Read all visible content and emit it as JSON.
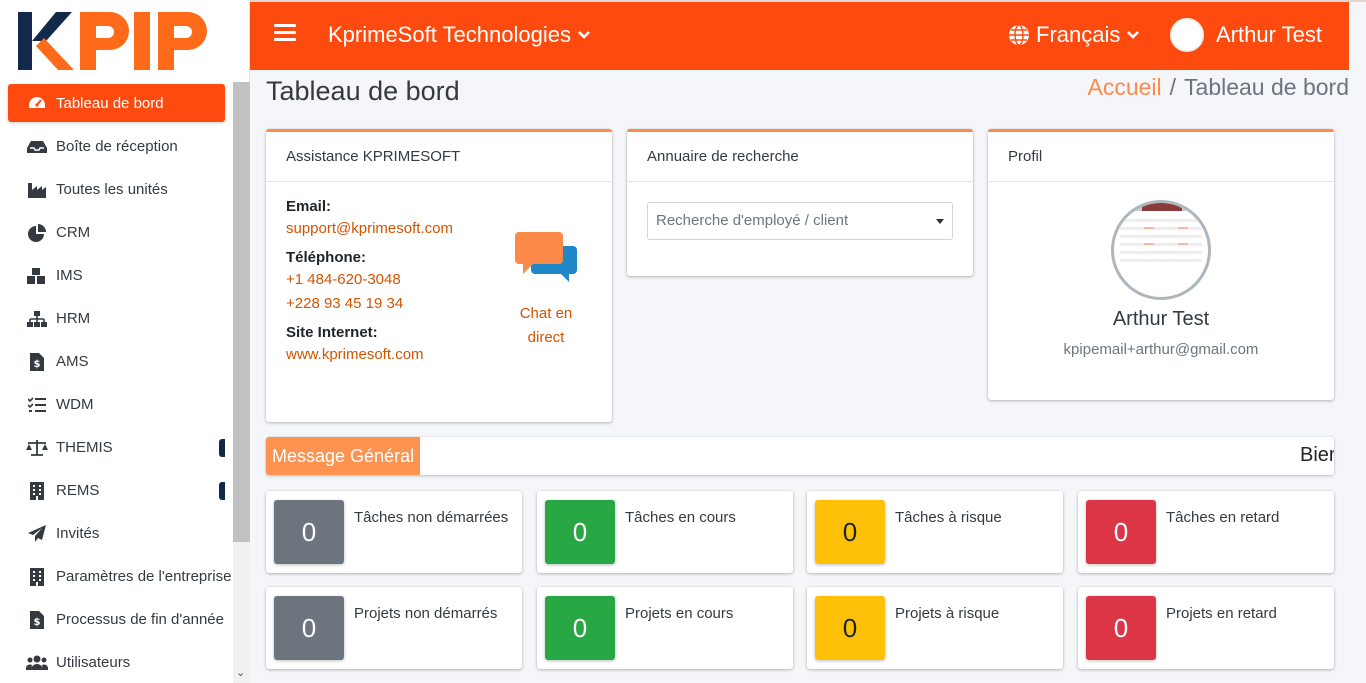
{
  "brand": {
    "logo_text": "KPIP",
    "accent": "#fd4b10"
  },
  "topbar": {
    "company": "KprimeSoft Technologies",
    "language": "Français",
    "user": "Arthur Test"
  },
  "sidebar": {
    "items": [
      {
        "label": "Tableau de bord",
        "icon": "dashboard-icon"
      },
      {
        "label": "Boîte de réception",
        "icon": "inbox-icon"
      },
      {
        "label": "Toutes les unités",
        "icon": "industry-icon"
      },
      {
        "label": "CRM",
        "icon": "pie-chart-icon"
      },
      {
        "label": "IMS",
        "icon": "boxes-icon"
      },
      {
        "label": "HRM",
        "icon": "sitemap-icon"
      },
      {
        "label": "AMS",
        "icon": "file-dollar-icon"
      },
      {
        "label": "WDM",
        "icon": "tasks-icon"
      },
      {
        "label": "THEMIS",
        "icon": "balance-scale-icon"
      },
      {
        "label": "REMS",
        "icon": "building-icon"
      },
      {
        "label": "Invités",
        "icon": "paper-plane-icon"
      },
      {
        "label": "Paramètres de l'entreprise",
        "icon": "building-icon"
      },
      {
        "label": "Processus de fin d'année",
        "icon": "file-dollar-icon"
      },
      {
        "label": "Utilisateurs",
        "icon": "users-icon"
      }
    ]
  },
  "page": {
    "title": "Tableau de bord",
    "breadcrumb_home": "Accueil",
    "breadcrumb_sep": "/",
    "breadcrumb_current": "Tableau de bord"
  },
  "assist": {
    "header": "Assistance KPRIMESOFT",
    "email_label": "Email:",
    "email": "support@kprimesoft.com",
    "phone_label": "Téléphone:",
    "phone1": "+1 484-620-3048",
    "phone2": "+228 93 45 19 34",
    "site_label": "Site Internet:",
    "site": "www.kprimesoft.com",
    "chat_line1": "Chat en",
    "chat_line2": "direct"
  },
  "directory": {
    "header": "Annuaire de recherche",
    "placeholder": "Recherche d'employé / client"
  },
  "profile": {
    "header": "Profil",
    "name": "Arthur Test",
    "email": "kpipemail+arthur@gmail.com"
  },
  "message": {
    "label": "Message Général",
    "scroll_text": "Bienvenue"
  },
  "stats": [
    {
      "value": "0",
      "label": "Tâches non démarrées",
      "color": "#6c757d"
    },
    {
      "value": "0",
      "label": "Tâches en cours",
      "color": "#28a745"
    },
    {
      "value": "0",
      "label": "Tâches à risque",
      "color": "#ffc107"
    },
    {
      "value": "0",
      "label": "Tâches en retard",
      "color": "#dc3545"
    },
    {
      "value": "0",
      "label": "Projets non démarrés",
      "color": "#6c757d"
    },
    {
      "value": "0",
      "label": "Projets en cours",
      "color": "#28a745"
    },
    {
      "value": "0",
      "label": "Projets à risque",
      "color": "#ffc107"
    },
    {
      "value": "0",
      "label": "Projets en retard",
      "color": "#dc3545"
    }
  ]
}
